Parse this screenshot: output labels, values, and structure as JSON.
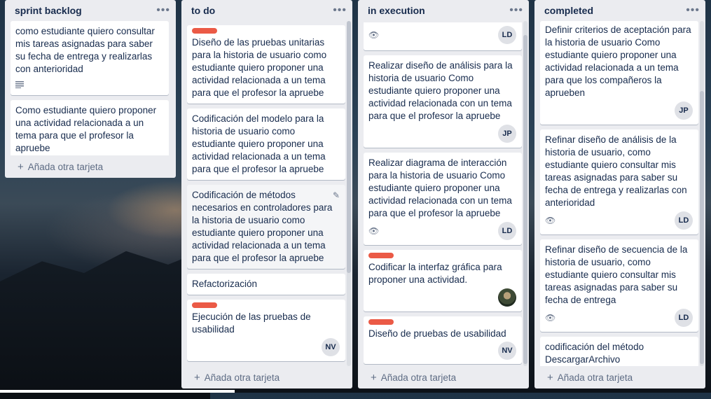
{
  "lists": [
    {
      "title": "sprint backlog",
      "menu": "•••",
      "add_card": "Añada otra tarjeta",
      "cards": [
        {
          "text": "como estudiante quiero consultar mis tareas asignadas para saber su fecha de entrega y realizarlas con anterioridad",
          "has_description": true
        },
        {
          "text": "Como estudiante quiero proponer una actividad relacionada a un tema para que el profesor la apruebe"
        }
      ]
    },
    {
      "title": "to do",
      "menu": "•••",
      "add_card": "Añada otra tarjeta",
      "cards": [
        {
          "text": "Diseño de las pruebas unitarias para la historia de usuario como estudiante quiero proponer una actividad relacionada a un tema para que el profesor la apruebe",
          "label": "red"
        },
        {
          "text": "Codificación del modelo para la historia de usuario como estudiante quiero proponer una actividad relacionada a un tema para que el profesor la apruebe"
        },
        {
          "text": "Codificación de métodos necesarios en controladores para la historia de usuario como estudiante quiero proponer una actividad relacionada a un tema para que el profesor la apruebe",
          "hover": true
        },
        {
          "text": "Refactorización"
        },
        {
          "text": "Ejecución de las pruebas de usabilidad",
          "label": "red",
          "member": "NV"
        }
      ]
    },
    {
      "title": "in execution",
      "menu": "•••",
      "add_card": "Añada otra tarjeta",
      "cards": [
        {
          "text": "Realizar diseño de análisis para la historia de usuario Como estudiante quiero proponer una actividad relacionada con un tema para que el profesor la apruebe",
          "member": "JP"
        },
        {
          "text": "Realizar diagrama de interacción para la historia de usuario Como estudiante quiero proponer una actividad relacionada con un tema para que el profesor la apruebe",
          "member": "LD",
          "watch": true
        },
        {
          "text": "Codificar la interfaz gráfica para proponer una actividad.",
          "label": "red",
          "photo": true
        },
        {
          "text": "Diseño de pruebas de usabilidad",
          "label": "red",
          "member": "NV"
        }
      ],
      "partial_top_member": "LD"
    },
    {
      "title": "completed",
      "menu": "•••",
      "add_card": "Añada otra tarjeta",
      "cards": [
        {
          "text": "Definir criterios de aceptación para la historia de usuario Como estudiante quiero proponer una actividad relacionada a un tema para que los compañeros la aprueben",
          "member": "JP"
        },
        {
          "text": "Refinar diseño de análisis de la historia de usuario, como estudiante quiero consultar mis tareas asignadas para saber su fecha de entrega y realizarlas con anterioridad",
          "member": "LD",
          "watch": true
        },
        {
          "text": "Refinar diseño de secuencia de la historia de usuario, como estudiante quiero consultar mis tareas asignadas para saber su fecha de entrega",
          "member": "LD",
          "watch": true
        },
        {
          "text": "codificación del método DescargarArchivo",
          "photo": true
        }
      ]
    }
  ],
  "icons": {
    "menu": "ellipsis-icon",
    "description": "description-icon",
    "watch": "eye-icon",
    "edit": "pencil-icon",
    "add": "plus-icon"
  },
  "colors": {
    "label_red": "#eb5a46",
    "list_bg": "#ebecf0"
  }
}
